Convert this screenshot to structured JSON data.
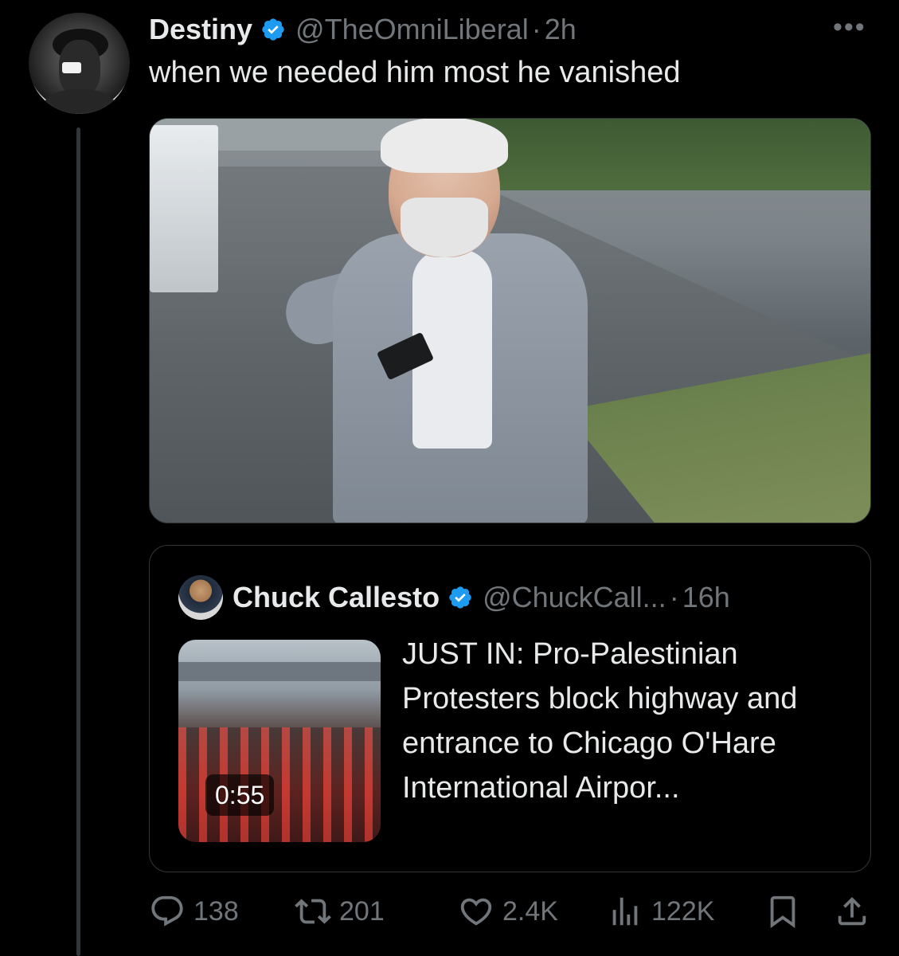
{
  "tweet": {
    "author_name": "Destiny",
    "handle": "@TheOmniLiberal",
    "separator": "·",
    "time": "2h",
    "text": "when we needed him most he vanished",
    "more_label": "•••"
  },
  "quoted_tweet": {
    "author_name": "Chuck Callesto",
    "handle": "@ChuckCall...",
    "separator": "·",
    "time": "16h",
    "text": "JUST IN: Pro-Palestinian Protesters block highway and entrance to Chicago O'Hare International Airpor...",
    "video_duration": "0:55"
  },
  "actions": {
    "replies": "138",
    "reposts": "201",
    "likes": "2.4K",
    "views": "122K"
  },
  "colors": {
    "background": "#000000",
    "text_primary": "#e7e9ea",
    "text_secondary": "#71767b",
    "verified_blue": "#1d9bf0",
    "border": "#333639"
  },
  "icons": [
    "verified-badge-icon",
    "more-icon",
    "reply-icon",
    "retweet-icon",
    "like-icon",
    "views-icon",
    "bookmark-icon",
    "share-icon"
  ]
}
